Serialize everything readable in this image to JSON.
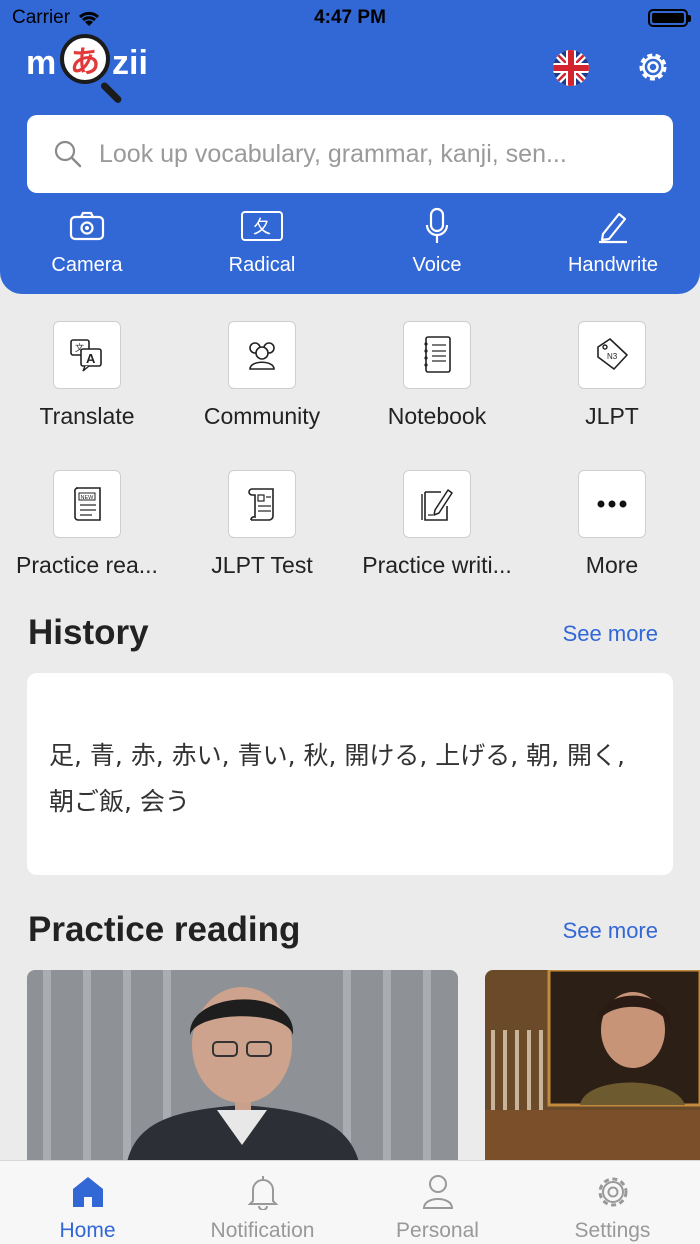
{
  "status_bar": {
    "carrier": "Carrier",
    "time": "4:47 PM"
  },
  "logo": {
    "part1": "m",
    "kana": "あ",
    "part2": "zii"
  },
  "search": {
    "placeholder": "Look up vocabulary, grammar, kanji, sen..."
  },
  "tools": [
    {
      "label": "Camera",
      "icon": "camera-icon"
    },
    {
      "label": "Radical",
      "icon": "radical-icon",
      "glyph": "夂"
    },
    {
      "label": "Voice",
      "icon": "microphone-icon"
    },
    {
      "label": "Handwrite",
      "icon": "pencil-icon"
    }
  ],
  "features": [
    {
      "label": "Translate",
      "icon": "translate-icon"
    },
    {
      "label": "Community",
      "icon": "community-icon"
    },
    {
      "label": "Notebook",
      "icon": "notebook-icon"
    },
    {
      "label": "JLPT",
      "icon": "jlpt-tag-icon",
      "tag": "N3"
    },
    {
      "label": "Practice rea...",
      "icon": "news-icon",
      "tag": "NEW"
    },
    {
      "label": "JLPT Test",
      "icon": "test-scroll-icon"
    },
    {
      "label": "Practice writi...",
      "icon": "writing-icon"
    },
    {
      "label": "More",
      "icon": "more-icon"
    }
  ],
  "history": {
    "title": "History",
    "see_more": "See more",
    "items": "足, 青, 赤, 赤い, 青い, 秋, 開ける, 上げる, 朝, 開く, 朝ご飯, 会う"
  },
  "practice_reading": {
    "title": "Practice reading",
    "see_more": "See more"
  },
  "tabbar": [
    {
      "label": "Home",
      "icon": "home-icon",
      "active": true
    },
    {
      "label": "Notification",
      "icon": "bell-icon",
      "active": false
    },
    {
      "label": "Personal",
      "icon": "person-icon",
      "active": false
    },
    {
      "label": "Settings",
      "icon": "gear-icon",
      "active": false
    }
  ],
  "colors": {
    "brand": "#3267d6",
    "background": "#ebebeb",
    "logo_accent": "#e23a3a"
  }
}
